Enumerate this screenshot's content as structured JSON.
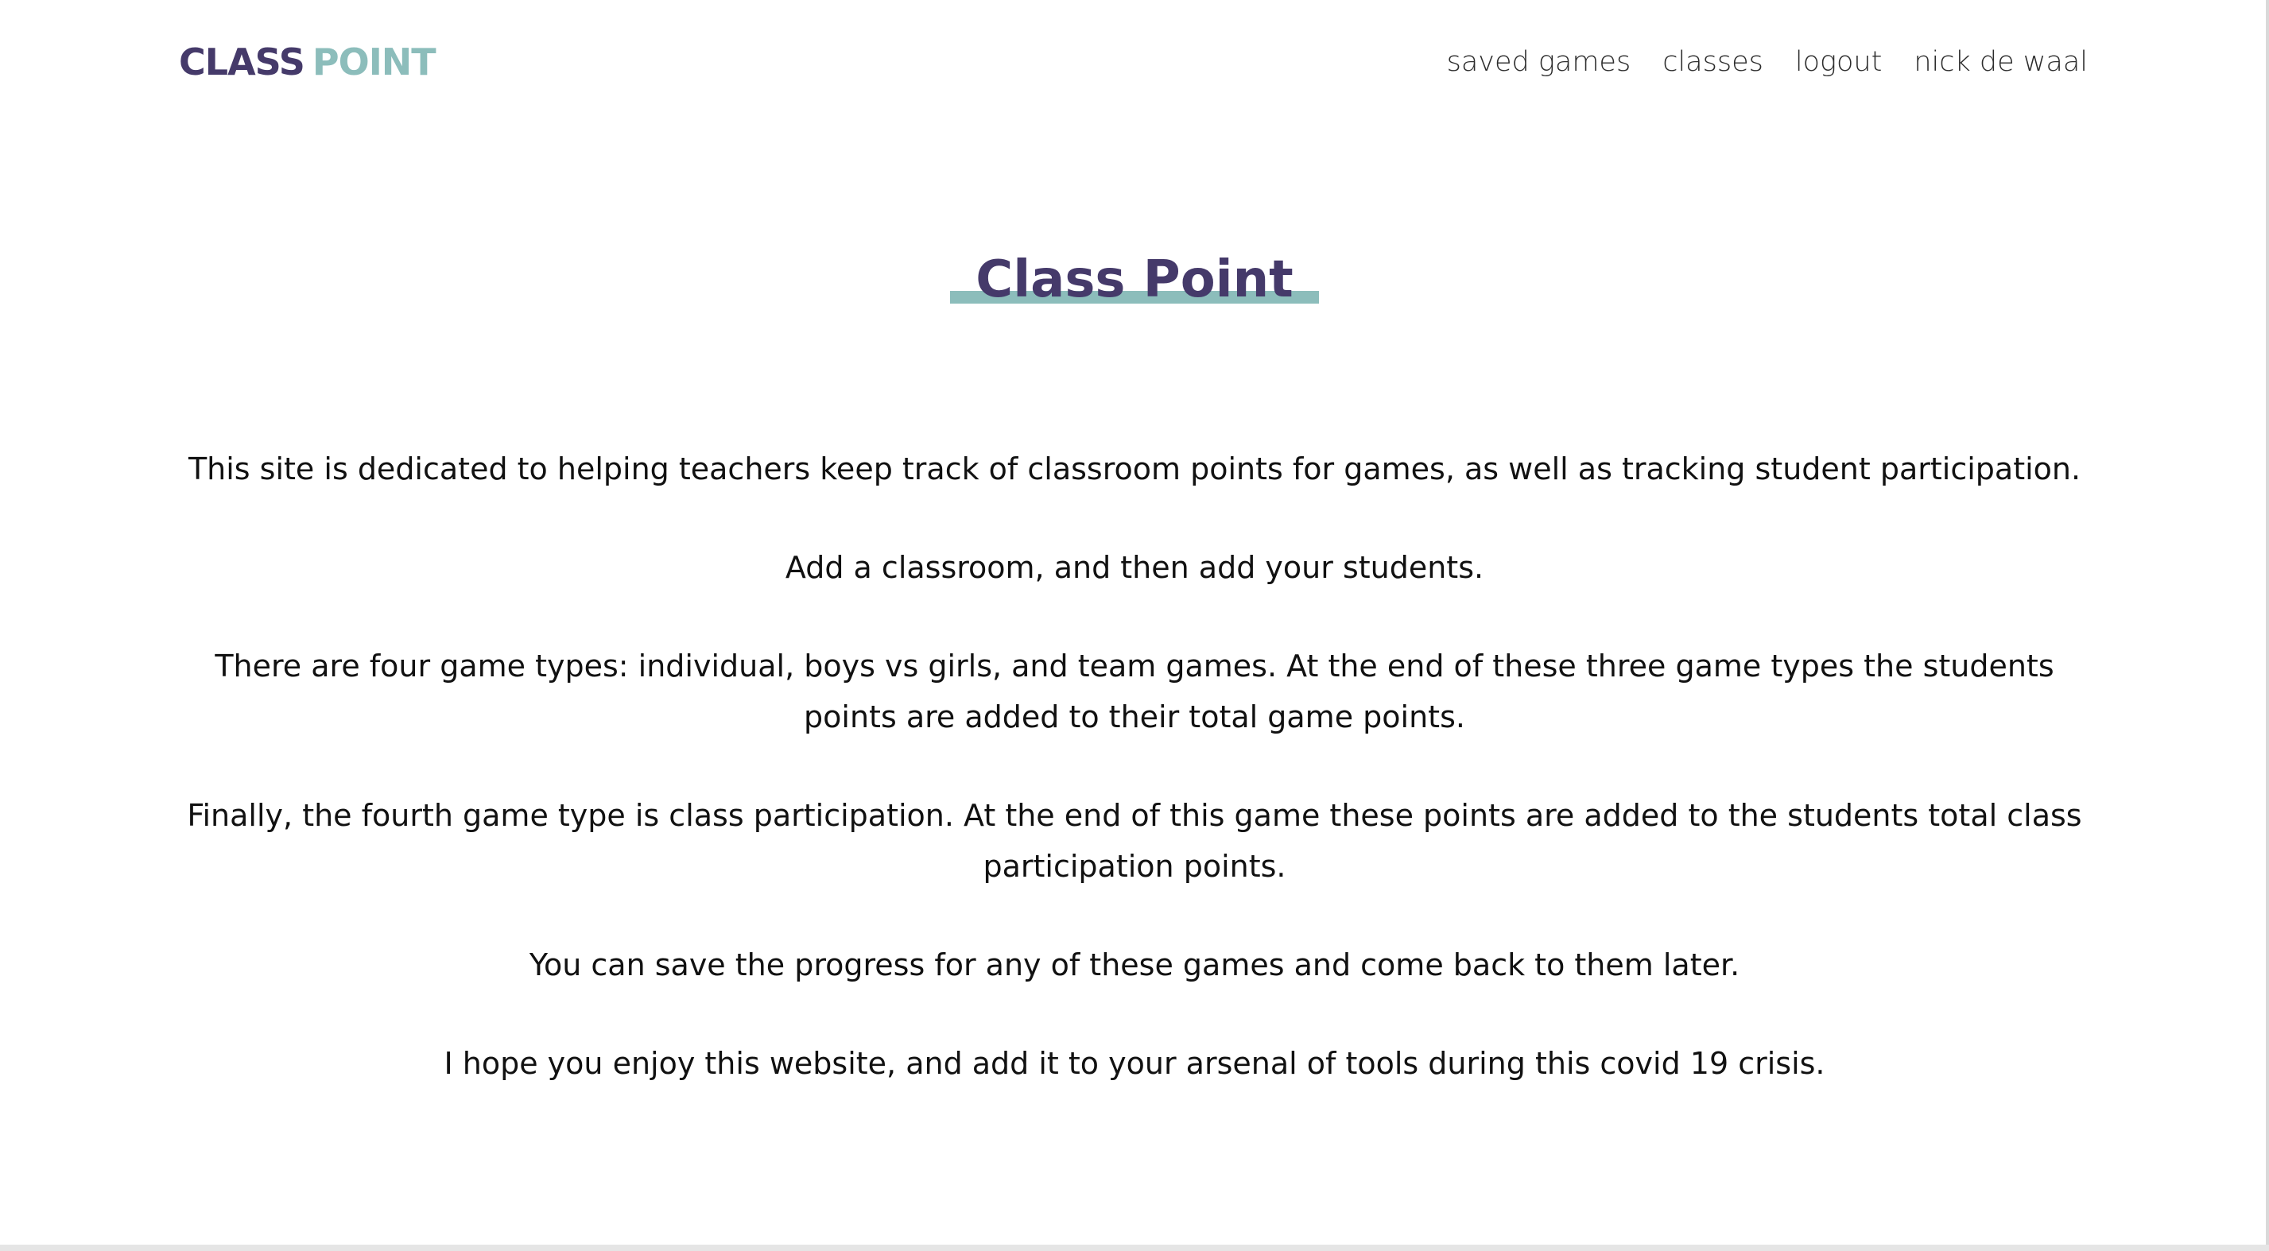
{
  "brand": {
    "part1": "CLASS",
    "part2": "POINT",
    "colors": {
      "dark": "#453a6a",
      "teal": "#8cbdbb"
    }
  },
  "nav": {
    "items": [
      {
        "label": "saved games"
      },
      {
        "label": "classes"
      },
      {
        "label": "logout"
      },
      {
        "label": "nick de waal"
      }
    ]
  },
  "hero": {
    "title": "Class Point"
  },
  "content": {
    "paragraphs": [
      "This site is dedicated to helping teachers keep track of classroom points for games, as well as tracking student participation.",
      "Add a classroom, and then add your students.",
      "There are four game types: individual, boys vs girls, and team games. At the end of these three game types the students points are added to their total game points.",
      "Finally, the fourth game type is class participation. At the end of this game these points are added to the students total class participation points.",
      "You can save the progress for any of these games and come back to them later.",
      "I hope you enjoy this website, and add it to your arsenal of tools during this covid 19 crisis."
    ]
  }
}
